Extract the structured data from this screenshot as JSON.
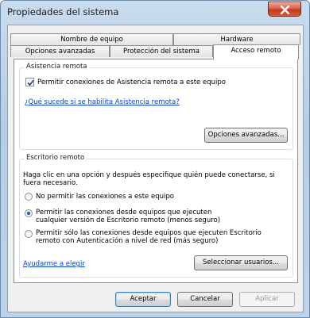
{
  "window": {
    "title": "Propiedades del sistema"
  },
  "tabs": {
    "row1": [
      "Nombre de equipo",
      "Hardware"
    ],
    "row2": [
      "Opciones avanzadas",
      "Protección del sistema",
      "Acceso remoto"
    ]
  },
  "remote_assistance": {
    "group_label": "Asistencia remota",
    "checkbox_label": "Permitir conexiones de Asistencia remota a este equipo",
    "checkbox_checked": true,
    "help_link": "¿Qué sucede si se habilita Asistencia remota?",
    "advanced_button": "Opciones avanzadas..."
  },
  "remote_desktop": {
    "group_label": "Escritorio remoto",
    "description_line1": "Haga clic en una opción y después especifique quién puede conectarse, si",
    "description_line2": "fuera necesario.",
    "option1": "No permitir las conexiones a este equipo",
    "option2_line1": "Permitir las conexiones desde equipos que ejecuten",
    "option2_line2": "cualquier versión de Escritorio remoto (menos seguro)",
    "option3_line1": "Permitir sólo las conexiones desde equipos que ejecuten Escritorio",
    "option3_line2": "remoto con Autenticación a nivel de red (más seguro)",
    "selected_option": 2,
    "help_link": "Ayudarme a elegir",
    "select_users_button": "Seleccionar usuarios..."
  },
  "footer": {
    "ok": "Aceptar",
    "cancel": "Cancelar",
    "apply": "Aplicar"
  }
}
